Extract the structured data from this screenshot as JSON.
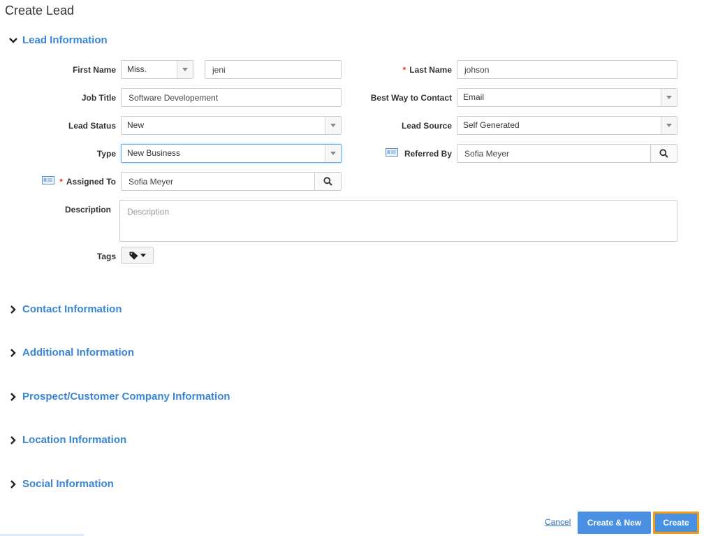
{
  "page": {
    "title": "Create Lead"
  },
  "sections": {
    "lead": "Lead Information",
    "contact": "Contact Information",
    "additional": "Additional Information",
    "company": "Prospect/Customer Company Information",
    "location": "Location Information",
    "social": "Social Information"
  },
  "form": {
    "first_name": {
      "label": "First Name",
      "salutation": "Miss.",
      "value": "jeni"
    },
    "last_name": {
      "label": "Last Name",
      "value": "johson",
      "required_mark": "*"
    },
    "job_title": {
      "label": "Job Title",
      "value": "Software Developement"
    },
    "best_way": {
      "label": "Best Way to Contact",
      "value": "Email"
    },
    "lead_status": {
      "label": "Lead Status",
      "value": "New"
    },
    "lead_source": {
      "label": "Lead Source",
      "value": "Self Generated"
    },
    "type": {
      "label": "Type",
      "value": "New Business"
    },
    "referred_by": {
      "label": "Referred By",
      "value": "Sofia Meyer"
    },
    "assigned_to": {
      "label": "Assigned To",
      "value": "Sofia Meyer",
      "required_mark": "*"
    },
    "description": {
      "label": "Description",
      "placeholder": "Description"
    },
    "tags": {
      "label": "Tags"
    }
  },
  "actions": {
    "cancel": "Cancel",
    "create_new": "Create & New",
    "create": "Create"
  },
  "colors": {
    "accent": "#3a85d4",
    "primary_button": "#4a90e2",
    "focus_outline": "#f39c12",
    "required": "#d9342b"
  },
  "icons": {
    "expanded": "chevron-down-icon",
    "collapsed": "chevron-right-icon",
    "dropdown": "caret-down-icon",
    "lookup": "search-icon",
    "card": "contact-card-icon",
    "tag": "tag-icon"
  }
}
